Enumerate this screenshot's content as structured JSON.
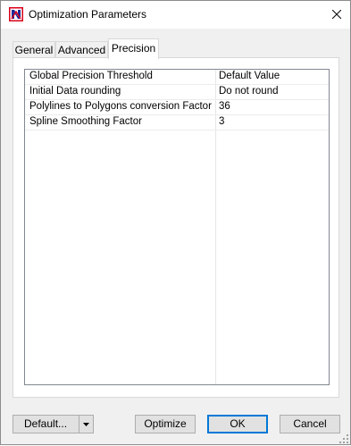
{
  "window": {
    "title": "Optimization Parameters",
    "app_icon": "app-logo-icon",
    "close_icon": "close-icon"
  },
  "tabs": [
    {
      "label": "General",
      "active": false
    },
    {
      "label": "Advanced",
      "active": false
    },
    {
      "label": "Precision",
      "active": true
    }
  ],
  "properties": [
    {
      "name": "Global Precision Threshold",
      "value": "Default Value"
    },
    {
      "name": "Initial Data rounding",
      "value": "Do not round"
    },
    {
      "name": "Polylines to Polygons conversion Factor",
      "value": "36"
    },
    {
      "name": "Spline Smoothing Factor",
      "value": "3"
    }
  ],
  "buttons": {
    "default_label": "Default...",
    "optimize_label": "Optimize",
    "ok_label": "OK",
    "cancel_label": "Cancel"
  },
  "colors": {
    "accent": "#0078d7",
    "logo_red": "#d9001b",
    "logo_blue": "#1a2a9c"
  }
}
